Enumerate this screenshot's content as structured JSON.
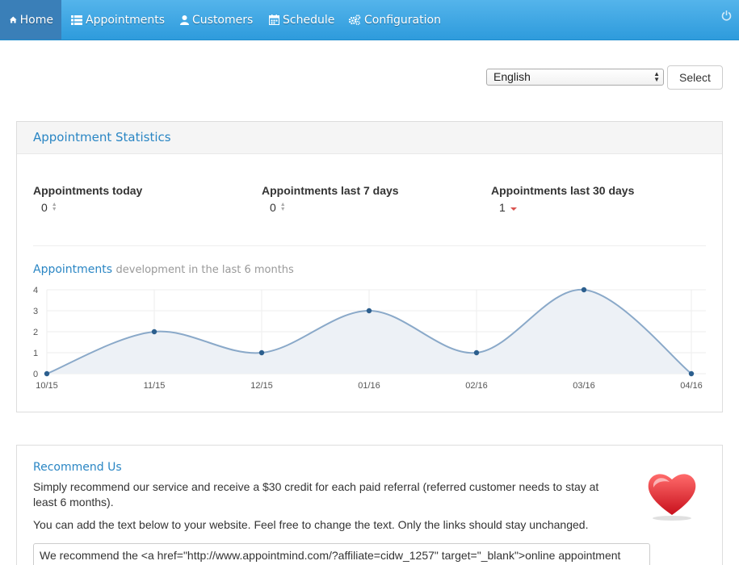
{
  "nav": {
    "items": [
      {
        "label": "Home",
        "icon": "home-icon"
      },
      {
        "label": "Appointments",
        "icon": "list-icon"
      },
      {
        "label": "Customers",
        "icon": "user-icon"
      },
      {
        "label": "Schedule",
        "icon": "calendar-icon"
      },
      {
        "label": "Configuration",
        "icon": "cogs-icon"
      }
    ],
    "power_icon": "power-icon"
  },
  "language": {
    "selected": "English",
    "button": "Select"
  },
  "stats": {
    "title": "Appointment Statistics",
    "items": [
      {
        "label": "Appointments today",
        "value": "0",
        "trend": "neutral"
      },
      {
        "label": "Appointments last 7 days",
        "value": "0",
        "trend": "neutral"
      },
      {
        "label": "Appointments last 30 days",
        "value": "1",
        "trend": "down"
      }
    ]
  },
  "chart_heading": {
    "strong": "Appointments",
    "muted": "development in the last 6 months"
  },
  "chart_data": {
    "type": "area",
    "categories": [
      "10/15",
      "11/15",
      "12/15",
      "01/16",
      "02/16",
      "03/16",
      "04/16"
    ],
    "values": [
      0,
      2,
      1,
      3,
      1,
      4,
      0
    ],
    "ylim": [
      0,
      4
    ],
    "yticks": [
      "0",
      "1",
      "2",
      "3",
      "4"
    ],
    "grid": true,
    "colors": {
      "line": "#8aa9c9",
      "fill": "#edf1f6",
      "point": "#2c5f8e"
    }
  },
  "recommend": {
    "title": "Recommend Us",
    "text1": "Simply recommend our service and receive a $30 credit for each paid referral (referred customer needs to stay at least 6 months).",
    "text2": "You can add the text below to your website. Feel free to change the text. Only the links should stay unchanged.",
    "code": "We recommend the <a href=\"http://www.appointmind.com/?affiliate=cidw_1257\" target=\"_blank\">online appointment",
    "heart_icon": "heart-icon"
  }
}
